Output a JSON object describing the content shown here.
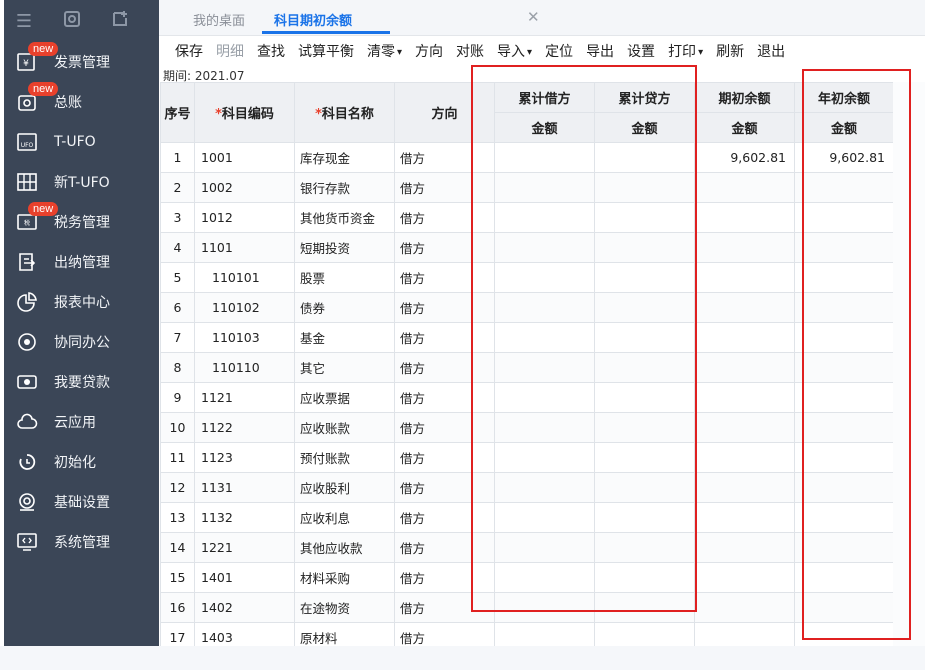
{
  "sidebar": {
    "top_icons": [
      "menu-icon",
      "search-window-icon",
      "add-window-icon"
    ],
    "items": [
      {
        "label": "发票管理",
        "icon": "invoice-icon",
        "badge": "new"
      },
      {
        "label": "总账",
        "icon": "ledger-icon",
        "badge": "new"
      },
      {
        "label": "T-UFO",
        "icon": "ufo-icon",
        "badge": ""
      },
      {
        "label": "新T-UFO",
        "icon": "new-ufo-icon",
        "badge": ""
      },
      {
        "label": "税务管理",
        "icon": "tax-icon",
        "badge": "new"
      },
      {
        "label": "出纳管理",
        "icon": "cashier-icon",
        "badge": ""
      },
      {
        "label": "报表中心",
        "icon": "pie-chart-icon",
        "badge": ""
      },
      {
        "label": "协同办公",
        "icon": "collaboration-icon",
        "badge": ""
      },
      {
        "label": "我要贷款",
        "icon": "loan-icon",
        "badge": ""
      },
      {
        "label": "云应用",
        "icon": "cloud-icon",
        "badge": ""
      },
      {
        "label": "初始化",
        "icon": "init-icon",
        "badge": ""
      },
      {
        "label": "基础设置",
        "icon": "settings-icon",
        "badge": ""
      },
      {
        "label": "系统管理",
        "icon": "system-icon",
        "badge": ""
      }
    ]
  },
  "tabs": [
    {
      "label": "我的桌面",
      "active": false
    },
    {
      "label": "科目期初余额",
      "active": true
    }
  ],
  "toolbar": {
    "save": "保存",
    "detail": "明细",
    "find": "查找",
    "trial_balance": "试算平衡",
    "zero": "清零",
    "direction": "方向",
    "reconcile": "对账",
    "import": "导入",
    "locate": "定位",
    "export": "导出",
    "settings": "设置",
    "print": "打印",
    "refresh": "刷新",
    "exit": "退出"
  },
  "period": "期间: 2021.07",
  "table": {
    "headers": {
      "idx": "序号",
      "code": "科目编码",
      "name": "科目名称",
      "dir": "方向",
      "cum_debit": "累计借方",
      "cum_credit": "累计贷方",
      "opening": "期初余额",
      "year_begin": "年初余额",
      "amount": "金额"
    },
    "rows": [
      {
        "idx": "1",
        "code": "1001",
        "name": "库存现金",
        "dir": "借方",
        "debit": "",
        "credit": "",
        "opening": "9,602.81",
        "year": "9,602.81"
      },
      {
        "idx": "2",
        "code": "1002",
        "name": "银行存款",
        "dir": "借方",
        "debit": "",
        "credit": "",
        "opening": "",
        "year": ""
      },
      {
        "idx": "3",
        "code": "1012",
        "name": "其他货币资金",
        "dir": "借方",
        "debit": "",
        "credit": "",
        "opening": "",
        "year": ""
      },
      {
        "idx": "4",
        "code": "1101",
        "name": "短期投资",
        "dir": "借方",
        "debit": "",
        "credit": "",
        "opening": "",
        "year": ""
      },
      {
        "idx": "5",
        "code": "110101",
        "name": "股票",
        "dir": "借方",
        "debit": "",
        "credit": "",
        "opening": "",
        "year": ""
      },
      {
        "idx": "6",
        "code": "110102",
        "name": "债券",
        "dir": "借方",
        "debit": "",
        "credit": "",
        "opening": "",
        "year": ""
      },
      {
        "idx": "7",
        "code": "110103",
        "name": "基金",
        "dir": "借方",
        "debit": "",
        "credit": "",
        "opening": "",
        "year": ""
      },
      {
        "idx": "8",
        "code": "110110",
        "name": "其它",
        "dir": "借方",
        "debit": "",
        "credit": "",
        "opening": "",
        "year": ""
      },
      {
        "idx": "9",
        "code": "1121",
        "name": "应收票据",
        "dir": "借方",
        "debit": "",
        "credit": "",
        "opening": "",
        "year": ""
      },
      {
        "idx": "10",
        "code": "1122",
        "name": "应收账款",
        "dir": "借方",
        "debit": "",
        "credit": "",
        "opening": "",
        "year": ""
      },
      {
        "idx": "11",
        "code": "1123",
        "name": "预付账款",
        "dir": "借方",
        "debit": "",
        "credit": "",
        "opening": "",
        "year": ""
      },
      {
        "idx": "12",
        "code": "1131",
        "name": "应收股利",
        "dir": "借方",
        "debit": "",
        "credit": "",
        "opening": "",
        "year": ""
      },
      {
        "idx": "13",
        "code": "1132",
        "name": "应收利息",
        "dir": "借方",
        "debit": "",
        "credit": "",
        "opening": "",
        "year": ""
      },
      {
        "idx": "14",
        "code": "1221",
        "name": "其他应收款",
        "dir": "借方",
        "debit": "",
        "credit": "",
        "opening": "",
        "year": ""
      },
      {
        "idx": "15",
        "code": "1401",
        "name": "材料采购",
        "dir": "借方",
        "debit": "",
        "credit": "",
        "opening": "",
        "year": ""
      },
      {
        "idx": "16",
        "code": "1402",
        "name": "在途物资",
        "dir": "借方",
        "debit": "",
        "credit": "",
        "opening": "",
        "year": ""
      },
      {
        "idx": "17",
        "code": "1403",
        "name": "原材料",
        "dir": "借方",
        "debit": "",
        "credit": "",
        "opening": "",
        "year": ""
      }
    ]
  },
  "colors": {
    "sidebar_bg": "#3b4657",
    "accent": "#1a73e8",
    "badge": "#e8412c",
    "highlight_box": "#e02020"
  }
}
